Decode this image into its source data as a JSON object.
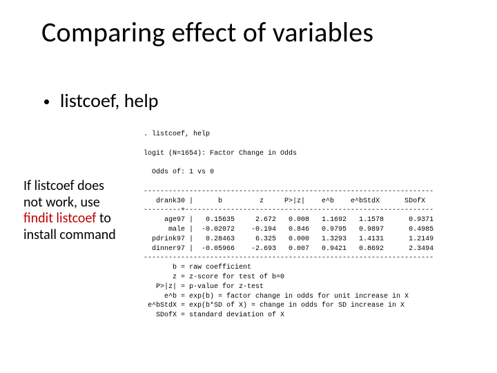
{
  "title": "Comparing effect of variables",
  "bullet": "listcoef, help",
  "sidenote": {
    "line1": "If listcoef does",
    "line2": "not work, use",
    "line3a": "findit listcoef",
    "line3b": " to",
    "line4": "install command"
  },
  "console": {
    "cmd": ". listcoef, help",
    "model_line": "logit (N=1654): Factor Change in Odds",
    "odds_line": "  Odds of: 1 vs 0",
    "sep_long": "----------------------------------------------------------------------",
    "header": "   drank30 |      b         z     P>|z|    e^b    e^bStdX      SDofX",
    "sep_plus": "---------+------------------------------------------------------------",
    "rows": [
      "     age97 |   0.15635     2.672   0.008   1.1692   1.1578      0.9371",
      "      male |  -0.02072    -0.194   0.846   0.9795   0.9897      0.4985",
      "  pdrink97 |   0.28463     6.325   0.000   1.3293   1.4131      1.2149",
      "  dinner97 |  -0.05966    -2.693   0.007   0.9421   0.8692      2.3494"
    ],
    "legend": [
      "       b = raw coefficient",
      "       z = z-score for test of b=0",
      "   P>|z| = p-value for z-test",
      "     e^b = exp(b) = factor change in odds for unit increase in X",
      " e^bStdX = exp(b*SD of X) = change in odds for SD increase in X",
      "   SDofX = standard deviation of X"
    ]
  },
  "chart_data": {
    "type": "table",
    "title": "logit (N=1654): Factor Change in Odds — Odds of: 1 vs 0",
    "columns": [
      "variable",
      "b",
      "z",
      "P>|z|",
      "e^b",
      "e^bStdX",
      "SDofX"
    ],
    "rows": [
      {
        "variable": "age97",
        "b": 0.15635,
        "z": 2.672,
        "P>|z|": 0.008,
        "e^b": 1.1692,
        "e^bStdX": 1.1578,
        "SDofX": 0.9371
      },
      {
        "variable": "male",
        "b": -0.02072,
        "z": -0.194,
        "P>|z|": 0.846,
        "e^b": 0.9795,
        "e^bStdX": 0.9897,
        "SDofX": 0.4985
      },
      {
        "variable": "pdrink97",
        "b": 0.28463,
        "z": 6.325,
        "P>|z|": 0.0,
        "e^b": 1.3293,
        "e^bStdX": 1.4131,
        "SDofX": 1.2149
      },
      {
        "variable": "dinner97",
        "b": -0.05966,
        "z": -2.693,
        "P>|z|": 0.007,
        "e^b": 0.9421,
        "e^bStdX": 0.8692,
        "SDofX": 2.3494
      }
    ],
    "legend": {
      "b": "raw coefficient",
      "z": "z-score for test of b=0",
      "P>|z|": "p-value for z-test",
      "e^b": "exp(b) = factor change in odds for unit increase in X",
      "e^bStdX": "exp(b*SD of X) = change in odds for SD increase in X",
      "SDofX": "standard deviation of X"
    },
    "N": 1654,
    "outcome": "drank30"
  }
}
